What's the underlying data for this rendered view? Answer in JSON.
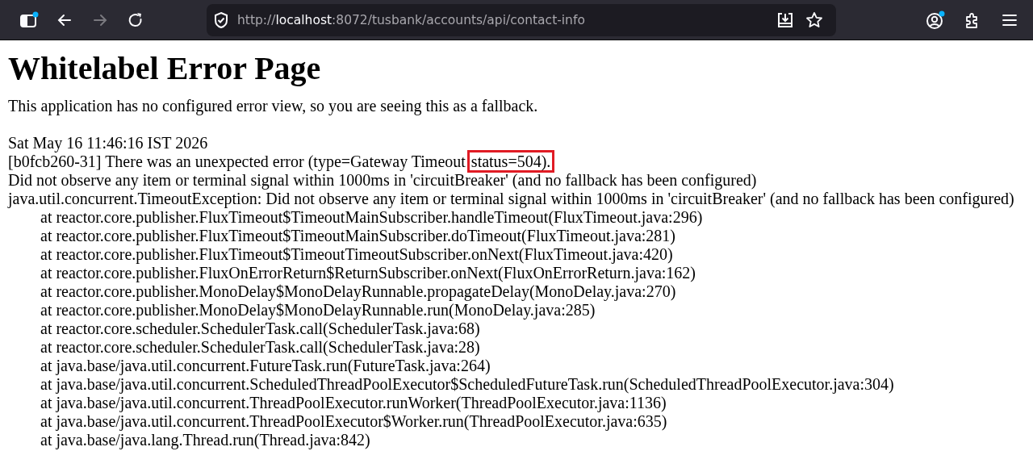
{
  "browser": {
    "url": "http://**localhost**:8072/tusbank/accounts/api/contact-info",
    "forward_disabled": true
  },
  "page": {
    "title": "Whitelabel Error Page",
    "message": "This application has no configured error view, so you are seeing this as a fallback.",
    "timestamp": "Sat May 16 11:46:16 IST 2026",
    "error_line": {
      "text": "[b0fcb260-31] There was an unexpected error (type=Gateway Timeout",
      "status": "status=504).",
      "highlighted": true
    },
    "details": [
      "Did not observe any item or terminal signal within 1000ms in 'circuitBreaker' (and no fallback has been configured)",
      "java.util.concurrent.TimeoutException: Did not observe any item or terminal signal within 1000ms in 'circuitBreaker' (and no fallback has been configured)"
    ],
    "trace": [
      "at reactor.core.publisher.FluxTimeout$TimeoutMainSubscriber.handleTimeout(FluxTimeout.java:296)",
      "at reactor.core.publisher.FluxTimeout$TimeoutMainSubscriber.doTimeout(FluxTimeout.java:281)",
      "at reactor.core.publisher.FluxTimeout$TimeoutTimeoutSubscriber.onNext(FluxTimeout.java:420)",
      "at reactor.core.publisher.FluxOnErrorReturn$ReturnSubscriber.onNext(FluxOnErrorReturn.java:162)",
      "at reactor.core.publisher.MonoDelay$MonoDelayRunnable.propagateDelay(MonoDelay.java:270)",
      "at reactor.core.publisher.MonoDelay$MonoDelayRunnable.run(MonoDelay.java:285)",
      "at reactor.core.scheduler.SchedulerTask.call(SchedulerTask.java:68)",
      "at reactor.core.scheduler.SchedulerTask.call(SchedulerTask.java:28)",
      "at java.base/java.util.concurrent.FutureTask.run(FutureTask.java:264)",
      "at java.base/java.util.concurrent.ScheduledThreadPoolExecutor$ScheduledFutureTask.run(ScheduledThreadPoolExecutor.java:304)",
      "at java.base/java.util.concurrent.ThreadPoolExecutor.runWorker(ThreadPoolExecutor.java:1136)",
      "at java.base/java.util.concurrent.ThreadPoolExecutor$Worker.run(ThreadPoolExecutor.java:635)",
      "at java.base/java.lang.Thread.run(Thread.java:842)"
    ]
  }
}
